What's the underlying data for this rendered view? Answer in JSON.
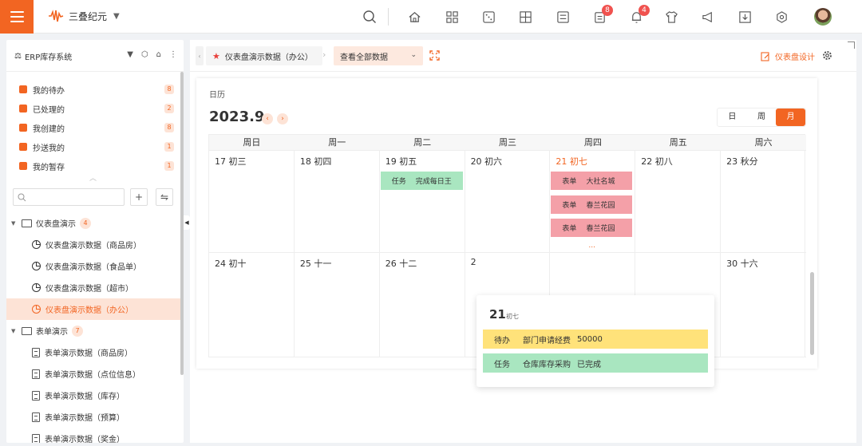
{
  "topbar": {
    "brand": "三叠纪元",
    "badges": {
      "clipboard": "8",
      "bell": "4"
    }
  },
  "sidebar": {
    "title": "ERP库存系统",
    "tasks": [
      {
        "label": "我的待办",
        "count": "8"
      },
      {
        "label": "已处理的",
        "count": "2"
      },
      {
        "label": "我创建的",
        "count": "8"
      },
      {
        "label": "抄送我的",
        "count": "1"
      },
      {
        "label": "我的暂存",
        "count": "1"
      }
    ],
    "search_placeholder": "",
    "groups": [
      {
        "label": "仪表盘演示",
        "count": "4",
        "items": [
          "仪表盘演示数据（商品房）",
          "仪表盘演示数据（食品单）",
          "仪表盘演示数据（超市）",
          "仪表盘演示数据（办公）"
        ]
      },
      {
        "label": "表单演示",
        "count": "7",
        "items": [
          "表单演示数据（商品房）",
          "表单演示数据（点位信息）",
          "表单演示数据（库存）",
          "表单演示数据（预算）",
          "表单演示数据（奖金）"
        ]
      }
    ]
  },
  "main": {
    "tab_label": "仪表盘演示数据（办公）",
    "view_select": "查看全部数据",
    "design_label": "仪表盘设计",
    "card_title": "日历",
    "month": "2023.9",
    "views": [
      "日",
      "周",
      "月"
    ],
    "weekdays": [
      "周日",
      "周一",
      "周二",
      "周三",
      "周四",
      "周五",
      "周六"
    ],
    "week1": [
      "17 初三",
      "18 初四",
      "19 初五",
      "20 初六",
      "21 初七",
      "22 初八",
      "23 秋分"
    ],
    "week2": [
      "24 初十",
      "25 十一",
      "26 十二",
      "2",
      "",
      "",
      "30 十六"
    ],
    "events": {
      "tue": {
        "type": "任务",
        "text": "完成每日王"
      },
      "thu": [
        {
          "type": "表单",
          "text": "大社名城"
        },
        {
          "type": "表单",
          "text": "春兰花园"
        },
        {
          "type": "表单",
          "text": "春兰花园"
        }
      ],
      "more": "..."
    },
    "popover": {
      "day": "21",
      "lunar": "初七",
      "events": [
        {
          "type": "待办",
          "text": "部门申请经费",
          "extra": "50000"
        },
        {
          "type": "任务",
          "text": "仓库库存采购",
          "extra": "已完成"
        }
      ]
    }
  },
  "colors": {
    "accent": "#f26522",
    "green_event": "#a9e6c0",
    "pink_event": "#f4a0a8",
    "yellow_event": "#ffe27a"
  }
}
